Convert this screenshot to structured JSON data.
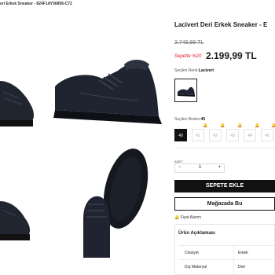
{
  "breadcrumb": "eri Erkek Sneaker - 824F1AY56896-C72",
  "product": {
    "title": "Lacivert Deri Erkek Sneaker - E",
    "old_price": "2.749,99 TL",
    "promo_label": "Sepette %20",
    "price": "2.199,99 TL",
    "color_label": "Seçilen Renk:",
    "color_value": "Lacivert",
    "size_label": "Seçilen Beden:",
    "size_value": "40",
    "sizes": [
      "40",
      "41",
      "42",
      "43",
      "44",
      "45"
    ],
    "qty_label": "ADET",
    "qty_minus": "−",
    "qty_value": "1",
    "qty_plus": "+",
    "cart_button": "SEPETE EKLE",
    "store_button": "Mağazada Bu",
    "price_alarm": "Fiyat Alarmı",
    "description_title": "Ürün Açıklaması",
    "specs": [
      {
        "key": "Cinsiyet",
        "value": "Erkek"
      },
      {
        "key": "Dış Materyal",
        "value": "Deri"
      }
    ]
  },
  "colors": {
    "promo": "#e0192c",
    "button": "#111111",
    "shoe": "#1f2430"
  }
}
